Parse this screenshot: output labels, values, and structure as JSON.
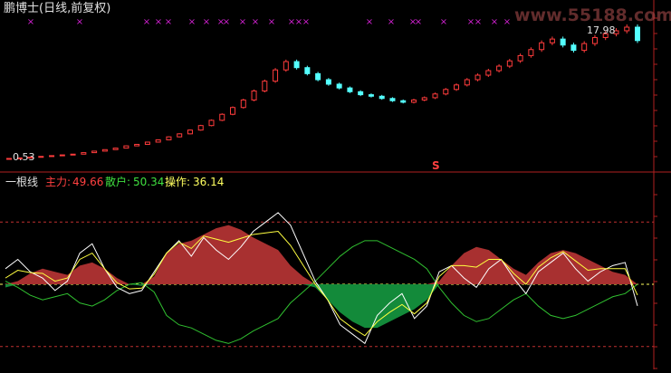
{
  "price_panel": {
    "title": "鹏博士(日线,前复权)",
    "price_high_label": "17.98",
    "price_low_label": "0.53",
    "signal_marker": "S",
    "watermark": "www.55188.com"
  },
  "indicator_panel": {
    "name": "一根线",
    "main_label": "主力:",
    "main_value": "49.66",
    "retail_label": "散户:",
    "retail_value": "50.34",
    "operate_label": "操作:",
    "operate_value": "36.14",
    "dashed_levels": [
      90,
      50,
      10
    ]
  },
  "colors": {
    "background": "#000000",
    "up_candle": "#ff3c3c",
    "down_candle": "#54ffff",
    "grid_red": "#7a1010",
    "x_marker": "#d020d0",
    "main_fill": "#a83030",
    "main_fill_neg": "#138a3a",
    "main_line": "#ffff40",
    "retail_line": "#30c030",
    "operate_line": "#ffffff",
    "label_red": "#ff4040",
    "label_green": "#40e040",
    "label_yellow": "#ffff60",
    "label_white": "#ffffff"
  },
  "chart_data": [
    {
      "type": "candlestick",
      "title": "鹏博士(日线,前复权)",
      "price_max": 17.98,
      "price_min": 0.53,
      "close_series": [
        0.53,
        0.6,
        0.7,
        0.8,
        0.9,
        1.0,
        1.1,
        1.3,
        1.5,
        1.7,
        1.9,
        2.2,
        2.4,
        2.7,
        3.0,
        3.4,
        3.8,
        4.3,
        4.9,
        5.6,
        6.4,
        7.3,
        8.3,
        9.5,
        10.8,
        12.3,
        13.4,
        12.6,
        11.8,
        11.0,
        10.4,
        9.9,
        9.4,
        9.0,
        8.8,
        8.5,
        8.2,
        8.0,
        8.3,
        8.6,
        9.1,
        9.7,
        10.3,
        11.0,
        11.6,
        12.2,
        12.8,
        13.5,
        14.2,
        15.0,
        15.9,
        16.4,
        15.6,
        14.9,
        15.8,
        16.6,
        17.1,
        17.5,
        17.98,
        16.2
      ],
      "x_markers": 24
    },
    {
      "type": "area",
      "series": [
        {
          "name": "主力",
          "values": [
            48,
            52,
            57,
            60,
            58,
            56,
            62,
            64,
            60,
            54,
            50,
            49,
            55,
            70,
            76,
            78,
            82,
            86,
            88,
            85,
            80,
            76,
            72,
            62,
            55,
            48,
            40,
            32,
            26,
            22,
            22,
            26,
            30,
            34,
            40,
            52,
            62,
            70,
            74,
            72,
            66,
            60,
            56,
            64,
            70,
            72,
            70,
            66,
            62,
            58,
            56,
            50
          ]
        },
        {
          "name": "散户",
          "values": [
            52,
            48,
            43,
            40,
            42,
            44,
            38,
            36,
            40,
            46,
            50,
            51,
            45,
            30,
            24,
            22,
            18,
            14,
            12,
            15,
            20,
            24,
            28,
            38,
            45,
            52,
            60,
            68,
            74,
            78,
            78,
            74,
            70,
            66,
            60,
            48,
            38,
            30,
            26,
            28,
            34,
            40,
            44,
            36,
            30,
            28,
            30,
            34,
            38,
            42,
            44,
            50
          ]
        },
        {
          "name": "操作",
          "values": [
            60,
            66,
            58,
            54,
            46,
            52,
            70,
            76,
            60,
            48,
            44,
            46,
            58,
            70,
            78,
            68,
            80,
            72,
            66,
            74,
            84,
            90,
            96,
            88,
            70,
            52,
            40,
            24,
            18,
            12,
            30,
            38,
            44,
            28,
            36,
            58,
            62,
            54,
            48,
            60,
            66,
            54,
            44,
            58,
            64,
            70,
            60,
            52,
            58,
            62,
            64,
            36.14
          ]
        }
      ]
    }
  ]
}
